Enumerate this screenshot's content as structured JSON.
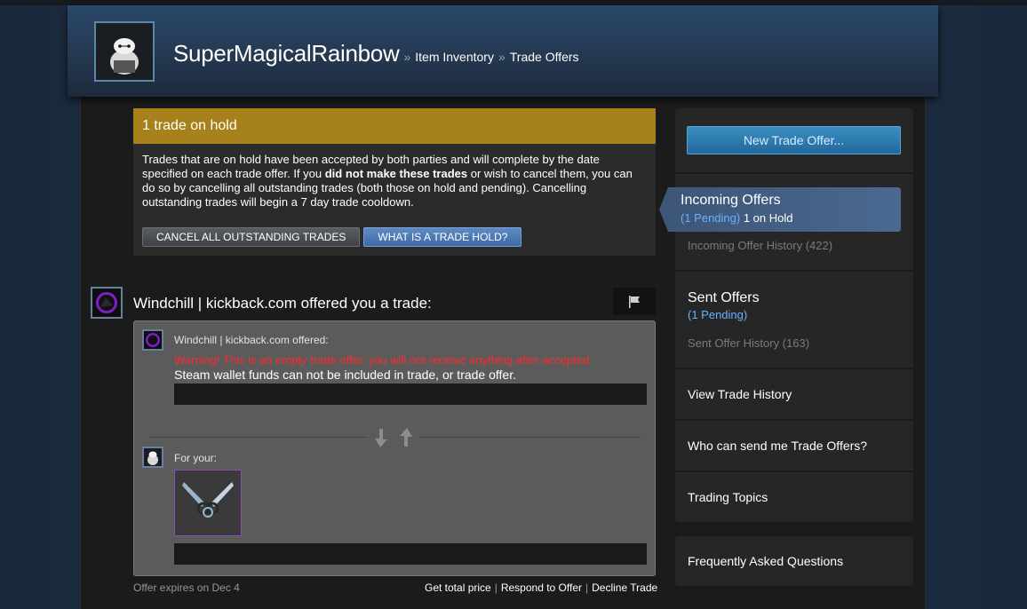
{
  "header": {
    "username": "SuperMagicalRainbow",
    "breadcrumbs": [
      "Item Inventory",
      "Trade Offers"
    ],
    "separator": "»"
  },
  "hold": {
    "title": "1 trade on hold",
    "text_1": "Trades that are on hold have been accepted by both parties and will complete by the date specified on each trade offer. If you ",
    "text_bold": "did not make these trades",
    "text_2": " or wish to cancel them, you can do so by cancelling all outstanding trades (both those on hold and pending). Cancelling outstanding trades will begin a 7 day trade cooldown.",
    "cancel_button": "CANCEL ALL OUTSTANDING TRADES",
    "what_button": "WHAT IS A TRADE HOLD?"
  },
  "offer": {
    "heading": "Windchill | kickback.com offered you a trade:",
    "partner_label": "Windchill | kickback.com offered:",
    "warning": "Warning! This is an empty trade offer, you will not receive anything after accepted.",
    "funds_note": "Steam wallet funds can not be included in trade, or trade offer.",
    "your_label": "For your:",
    "expires": "Offer expires on Dec 4",
    "actions": [
      "Get total price",
      "Respond to Offer",
      "Decline Trade"
    ],
    "action_separator": "|"
  },
  "sidebar": {
    "new_offer": "New Trade Offer...",
    "incoming": {
      "title": "Incoming Offers",
      "pending": "(1 Pending)",
      "on_hold": "1 on Hold",
      "history": "Incoming Offer History (422)"
    },
    "sent": {
      "title": "Sent Offers",
      "pending": "(1 Pending)",
      "history": "Sent Offer History (163)"
    },
    "links": [
      "View Trade History",
      "Who can send me Trade Offers?",
      "Trading Topics"
    ],
    "faq": "Frequently Asked Questions"
  },
  "colors": {
    "hold_banner": "#a7811c",
    "pending_blue": "#66b3ff",
    "warning_red": "#ff2a2a",
    "item_border": "#8a4fb7"
  }
}
